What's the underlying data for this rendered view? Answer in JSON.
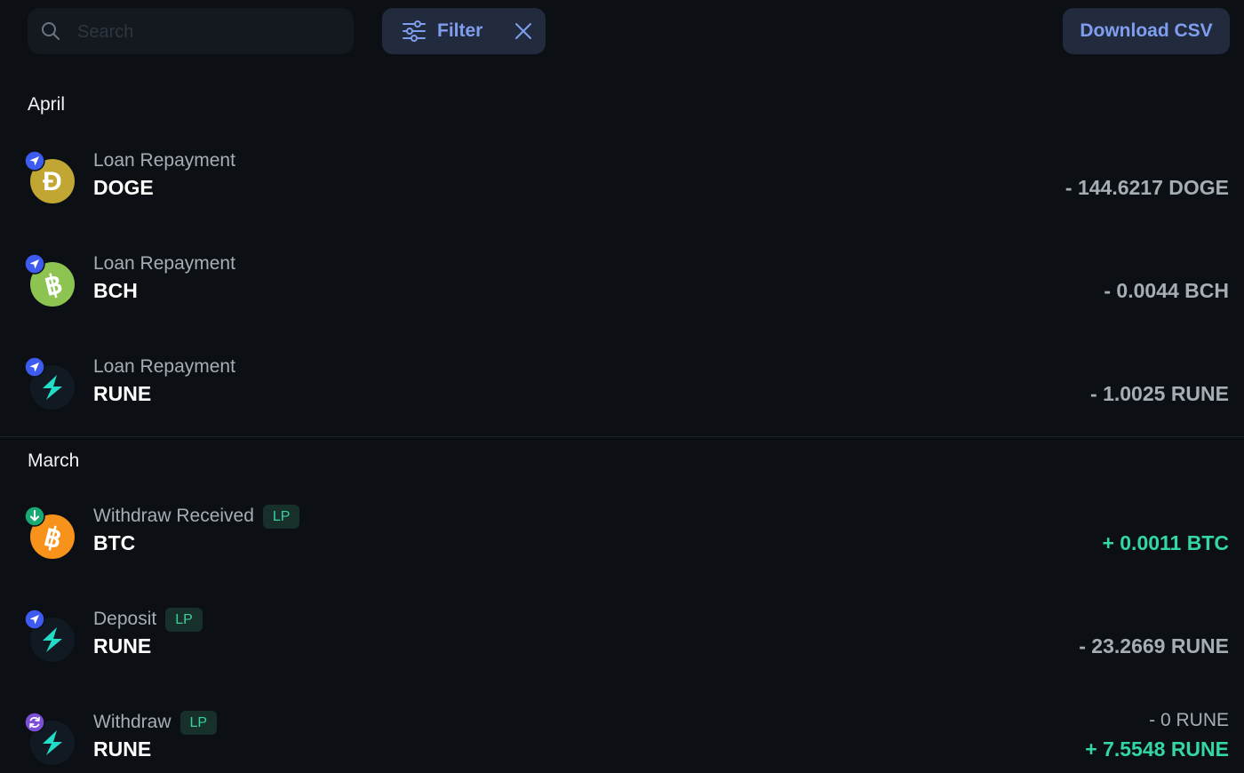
{
  "toolbar": {
    "search_placeholder": "Search",
    "filter_label": "Filter",
    "download_label": "Download CSV"
  },
  "groups": [
    {
      "month": "April",
      "transactions": [
        {
          "type": "Loan Repayment",
          "asset": "DOGE",
          "amount": "- 144.6217 DOGE",
          "coin_icon": "doge-icon",
          "badge_icon": "send-icon"
        },
        {
          "type": "Loan Repayment",
          "asset": "BCH",
          "amount": "- 0.0044 BCH",
          "coin_icon": "bch-icon",
          "badge_icon": "send-icon"
        },
        {
          "type": "Loan Repayment",
          "asset": "RUNE",
          "amount": "- 1.0025 RUNE",
          "coin_icon": "rune-icon",
          "badge_icon": "send-icon"
        }
      ]
    },
    {
      "month": "March",
      "transactions": [
        {
          "type": "Withdraw Received",
          "tag": "LP",
          "asset": "BTC",
          "amount": "+ 0.0011 BTC",
          "coin_icon": "btc-icon",
          "badge_icon": "receive-icon"
        },
        {
          "type": "Deposit",
          "tag": "LP",
          "asset": "RUNE",
          "amount": "- 23.2669 RUNE",
          "coin_icon": "rune-icon",
          "badge_icon": "send-icon"
        },
        {
          "type": "Withdraw",
          "tag": "LP",
          "asset": "RUNE",
          "amount_secondary": "- 0 RUNE",
          "amount": "+ 7.5548 RUNE",
          "coin_icon": "rune-icon",
          "badge_icon": "swap-icon"
        }
      ]
    }
  ],
  "colors": {
    "background": "#0c1014",
    "accent": "#7f9ef0",
    "positive": "#33d6a4",
    "muted": "#a5adb5",
    "send_badge": "#3d5af1",
    "receive_badge": "#19a974",
    "swap_badge": "#7b4fd6"
  }
}
